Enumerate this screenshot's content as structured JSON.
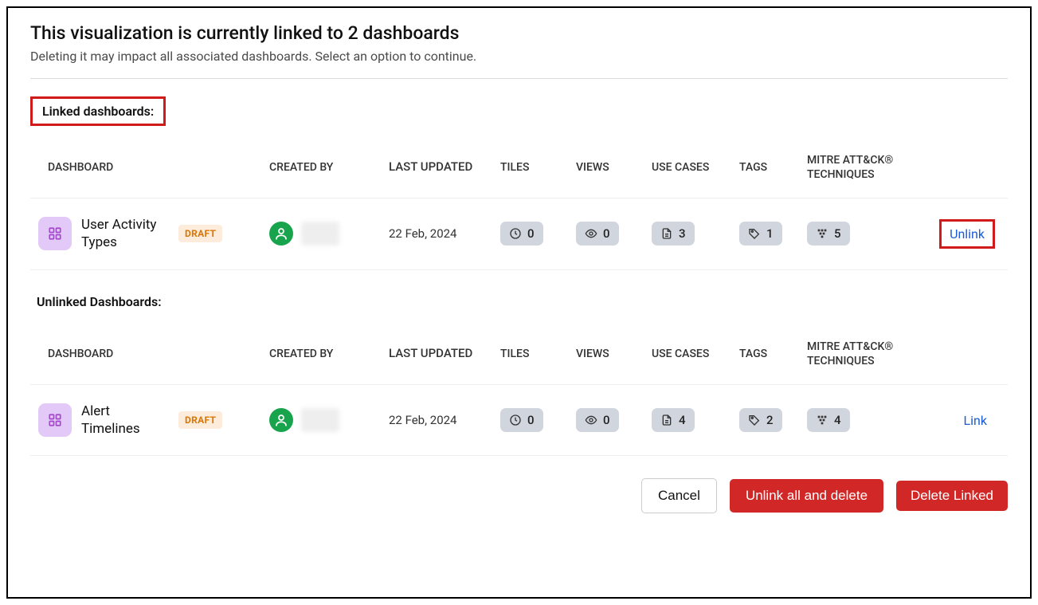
{
  "header": {
    "title": "This visualization is currently linked to 2 dashboards",
    "subtitle": "Deleting it may impact all associated dashboards. Select an option to continue."
  },
  "sections": {
    "linked_label": "Linked dashboards:",
    "unlinked_label": "Unlinked Dashboards:"
  },
  "columns": {
    "dashboard": "DASHBOARD",
    "created_by": "CREATED BY",
    "last_updated": "LAST UPDATED",
    "tiles": "TILES",
    "views": "VIEWS",
    "use_cases": "USE CASES",
    "tags": "TAGS",
    "mitre": "MITRE ATT&CK® TECHNIQUES"
  },
  "linked": [
    {
      "name": "User Activity Types",
      "status": "DRAFT",
      "last_updated": "22 Feb, 2024",
      "tiles": "0",
      "views": "0",
      "use_cases": "3",
      "tags": "1",
      "mitre": "5",
      "action_label": "Unlink"
    }
  ],
  "unlinked": [
    {
      "name": "Alert Timelines",
      "status": "DRAFT",
      "last_updated": "22 Feb, 2024",
      "tiles": "0",
      "views": "0",
      "use_cases": "4",
      "tags": "2",
      "mitre": "4",
      "action_label": "Link"
    }
  ],
  "footer": {
    "cancel": "Cancel",
    "unlink_all": "Unlink all and delete",
    "delete_linked": "Delete Linked"
  }
}
